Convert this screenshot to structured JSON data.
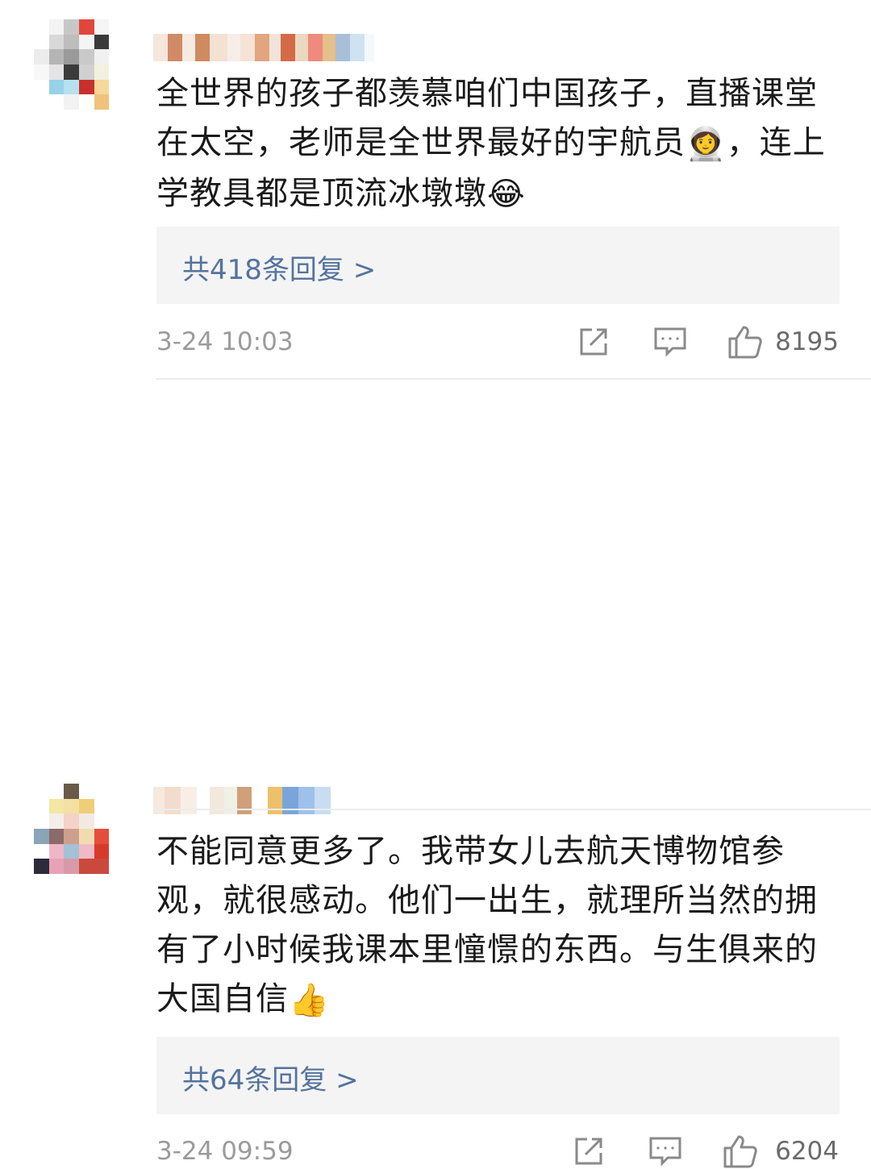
{
  "comments": [
    {
      "text": "全世界的孩子都羡慕咱们中国孩子，直播课堂在太空，老师是全世界最好的宇航员",
      "emoji1": "👩‍🚀",
      "text_after": "，连上学教具都是顶流冰墩墩",
      "emoji2": "😂",
      "reply_label": "共418条回复 >",
      "timestamp": "3-24 10:03",
      "likes": "8195",
      "icons": [
        "share-icon",
        "comment-icon",
        "like-icon"
      ]
    },
    {
      "text": "不能同意更多了。我带女儿去航天博物馆参观，就很感动。他们一出生，就理所当然的拥有了小时候我课本里憧憬的东西。与生俱来的大国自信",
      "emoji1": "👍",
      "reply_label": "共64条回复 >",
      "timestamp": "3-24 09:59",
      "likes": "6204",
      "icons": [
        "share-icon",
        "comment-icon",
        "like-icon"
      ]
    }
  ],
  "colors": {
    "reply_link": "#54739e",
    "reply_bg": "#f4f4f4",
    "meta_gray": "#9b9b9b"
  }
}
